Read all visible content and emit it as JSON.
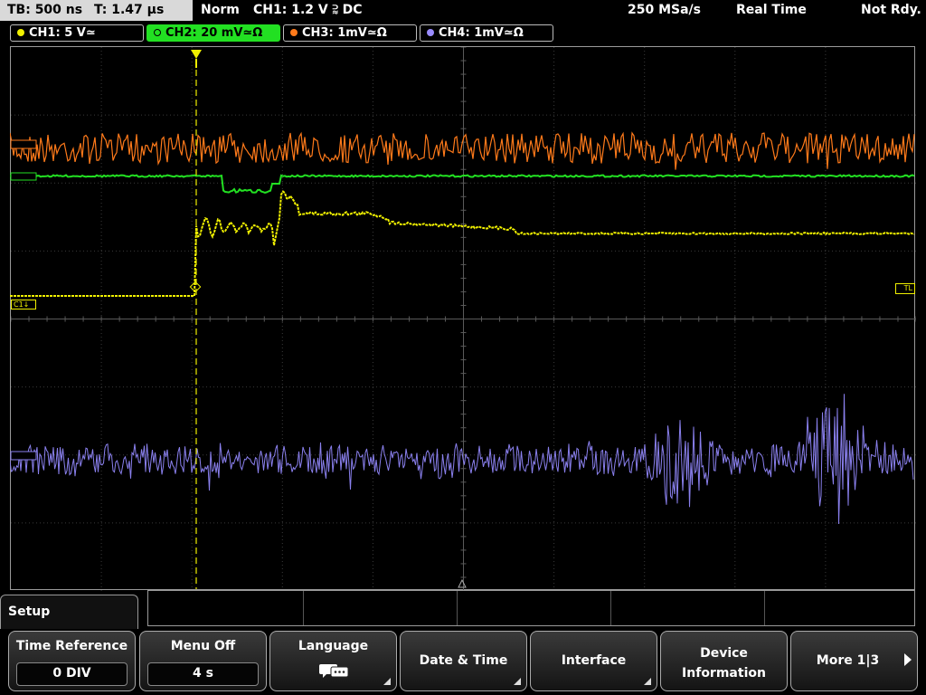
{
  "status": {
    "timebase": "TB: 500 ns",
    "trigger_pos": "T: 1.47 µs",
    "mode": "Norm",
    "trigger": "CH1: 1.2 V ⫊ DC",
    "sample_rate": "250 MSa/s",
    "acq_mode": "Real Time",
    "ready": "Not Rdy."
  },
  "channels": [
    {
      "label": "CH1: 5 V≃",
      "color": "#f0f000",
      "active": false
    },
    {
      "label": "CH2: 20 mV≃Ω",
      "color": "#22e022",
      "active": true
    },
    {
      "label": "CH3: 1mV≃Ω",
      "color": "#ff7a1a",
      "active": false
    },
    {
      "label": "CH4: 1mV≃Ω",
      "color": "#9a8cff",
      "active": false
    }
  ],
  "markers": {
    "c1": "C1↓",
    "tl": "TL"
  },
  "menu": {
    "title": "Setup"
  },
  "softkeys": {
    "time_reference": {
      "label": "Time Reference",
      "value": "0 DIV"
    },
    "menu_off": {
      "label": "Menu Off",
      "value": "4 s"
    },
    "language": {
      "label": "Language",
      "icon": "speech-bubble-icon"
    },
    "date_time": {
      "label": "Date & Time"
    },
    "interface": {
      "label": "Interface"
    },
    "device_info": {
      "label_line1": "Device",
      "label_line2": "Information"
    },
    "more": {
      "label": "More 1|3"
    }
  }
}
